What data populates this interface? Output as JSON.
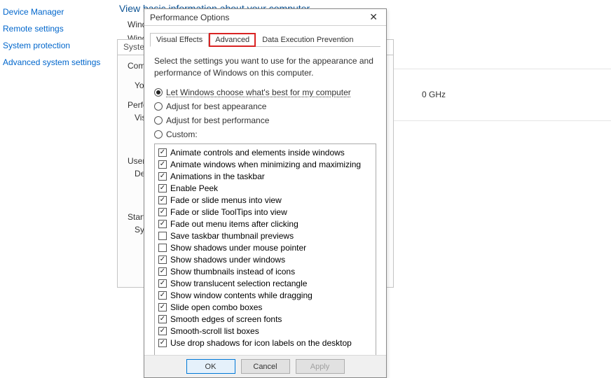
{
  "left_nav": {
    "items": [
      "Device Manager",
      "Remote settings",
      "System protection",
      "Advanced system settings"
    ]
  },
  "header": {
    "partial": "View basic information about your computer"
  },
  "partial_labels": {
    "windows1": "Windows",
    "windows2": "Wind"
  },
  "cpu": "0 GHz",
  "system_properties": {
    "tab1": "System Prope",
    "computer_na": "Computer Na",
    "you_must": "You must b",
    "performan": "Performan",
    "visual_ef": "Visual ef",
    "user_profil": "User Profil",
    "desktop": "Desktop s",
    "startup": "Startup an",
    "system_s": "System s"
  },
  "perf_options": {
    "title": "Performance Options",
    "tabs": {
      "visual_effects": "Visual Effects",
      "advanced": "Advanced",
      "dep": "Data Execution Prevention"
    },
    "description": "Select the settings you want to use for the appearance and performance of Windows on this computer.",
    "radios": {
      "auto": "Let Windows choose what's best for my computer",
      "appearance": "Adjust for best appearance",
      "performance": "Adjust for best performance",
      "custom": "Custom:"
    },
    "selected_radio": "auto",
    "checklist": [
      {
        "label": "Animate controls and elements inside windows",
        "checked": true
      },
      {
        "label": "Animate windows when minimizing and maximizing",
        "checked": true
      },
      {
        "label": "Animations in the taskbar",
        "checked": true
      },
      {
        "label": "Enable Peek",
        "checked": true
      },
      {
        "label": "Fade or slide menus into view",
        "checked": true
      },
      {
        "label": "Fade or slide ToolTips into view",
        "checked": true
      },
      {
        "label": "Fade out menu items after clicking",
        "checked": true
      },
      {
        "label": "Save taskbar thumbnail previews",
        "checked": false
      },
      {
        "label": "Show shadows under mouse pointer",
        "checked": false
      },
      {
        "label": "Show shadows under windows",
        "checked": true
      },
      {
        "label": "Show thumbnails instead of icons",
        "checked": true
      },
      {
        "label": "Show translucent selection rectangle",
        "checked": true
      },
      {
        "label": "Show window contents while dragging",
        "checked": true
      },
      {
        "label": "Slide open combo boxes",
        "checked": true
      },
      {
        "label": "Smooth edges of screen fonts",
        "checked": true
      },
      {
        "label": "Smooth-scroll list boxes",
        "checked": true
      },
      {
        "label": "Use drop shadows for icon labels on the desktop",
        "checked": true
      }
    ],
    "buttons": {
      "ok": "OK",
      "cancel": "Cancel",
      "apply": "Apply"
    }
  }
}
